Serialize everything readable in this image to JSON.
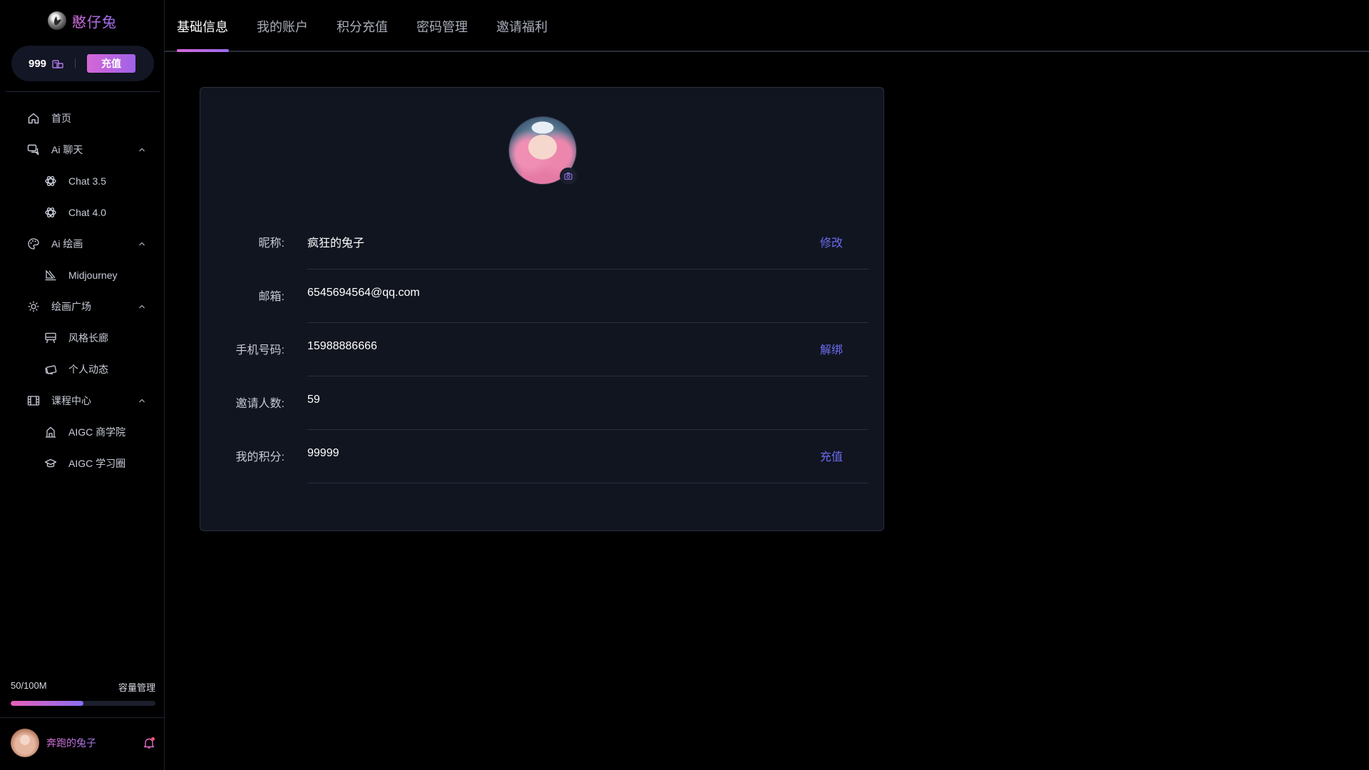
{
  "brand": {
    "name": "憨仔兔"
  },
  "credits": {
    "amount": "999",
    "recharge_label": "充值"
  },
  "nav": {
    "home": "首页",
    "ai_chat": "Ai 聊天",
    "chat35": "Chat 3.5",
    "chat40": "Chat 4.0",
    "ai_draw": "Ai 绘画",
    "midjourney": "Midjourney",
    "plaza": "绘画广场",
    "gallery": "风格长廊",
    "feed": "个人动态",
    "courses": "课程中心",
    "academy": "AIGC 商学院",
    "circle": "AIGC 学习圈"
  },
  "storage": {
    "usage": "50/100M",
    "manage_label": "容量管理",
    "fill_fraction": 0.5
  },
  "user": {
    "name": "奔跑的兔子"
  },
  "tabs": [
    "基础信息",
    "我的账户",
    "积分充值",
    "密码管理",
    "邀请福利"
  ],
  "profile": {
    "nickname_label": "昵称:",
    "nickname": "疯狂的兔子",
    "nickname_action": "修改",
    "email_label": "邮箱:",
    "email": "6545694564@qq.com",
    "phone_label": "手机号码:",
    "phone": "15988886666",
    "phone_action": "解绑",
    "invites_label": "邀请人数:",
    "invites": "59",
    "points_label": "我的积分:",
    "points": "99999",
    "points_action": "充值"
  },
  "colors": {
    "accent_pink": "#d767d8",
    "accent_purple": "#9c6cf0",
    "link_blue": "#6b6cf0",
    "card_bg": "#111520"
  }
}
